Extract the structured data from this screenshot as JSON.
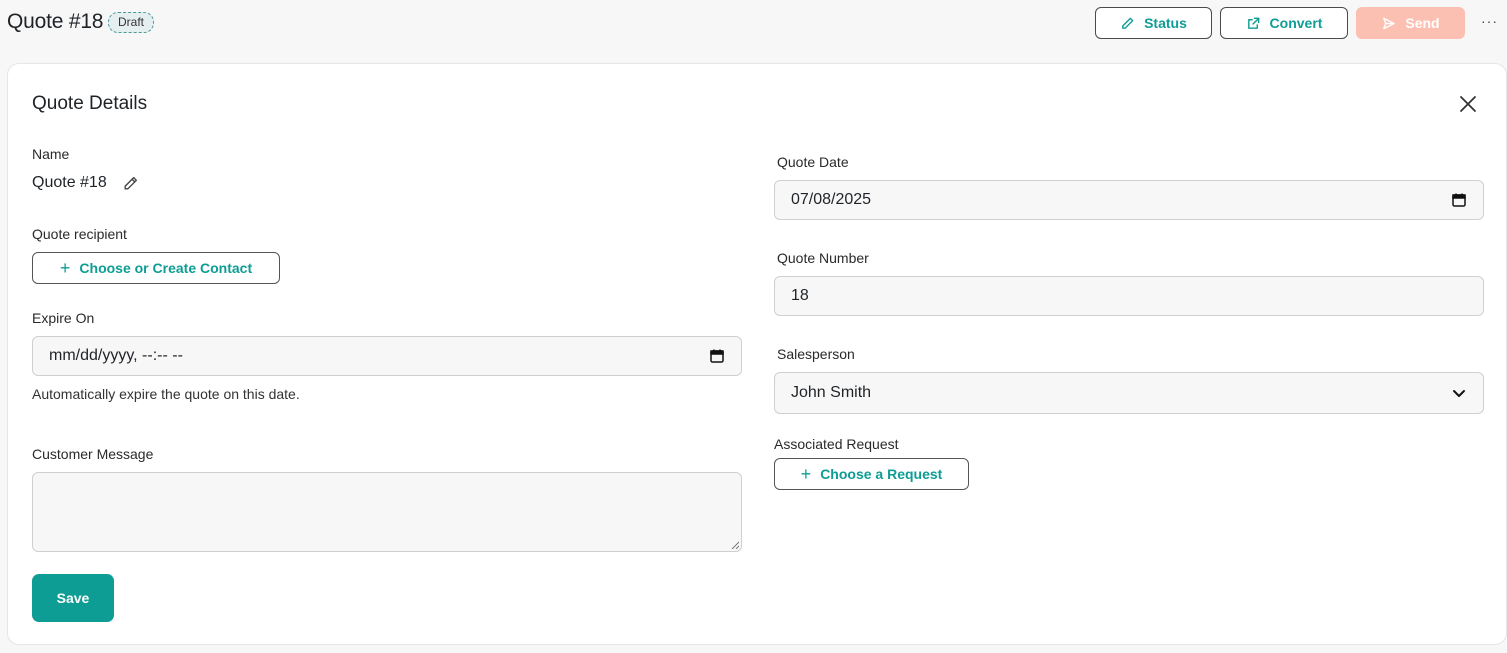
{
  "header": {
    "title": "Quote #18",
    "badge": "Draft",
    "status_label": "Status",
    "convert_label": "Convert",
    "send_label": "Send",
    "more_label": "···"
  },
  "card": {
    "title": "Quote Details",
    "name": {
      "label": "Name",
      "value": "Quote #18"
    },
    "recipient": {
      "label": "Quote recipient",
      "button": "Choose or Create Contact"
    },
    "expire": {
      "label": "Expire On",
      "value": "mm/dd/yyyy, --:-- --",
      "helper": "Automatically expire the quote on this date."
    },
    "message": {
      "label": "Customer Message",
      "value": ""
    },
    "save_label": "Save",
    "quote_date": {
      "label": "Quote Date",
      "value": "07/08/2025"
    },
    "quote_number": {
      "label": "Quote Number",
      "value": "18"
    },
    "salesperson": {
      "label": "Salesperson",
      "value": "John Smith"
    },
    "associated_request": {
      "label": "Associated Request",
      "button": "Choose a Request"
    }
  },
  "colors": {
    "accent": "#0e9d94",
    "send_disabled": "#fcc0b2",
    "badge_bg": "#e6efef"
  },
  "icons": {
    "status": "pencil-icon",
    "convert": "external-link-icon",
    "send": "send-icon",
    "close": "close-icon",
    "calendar": "calendar-icon",
    "dropdown": "chevron-down-icon",
    "plus": "plus-icon"
  }
}
